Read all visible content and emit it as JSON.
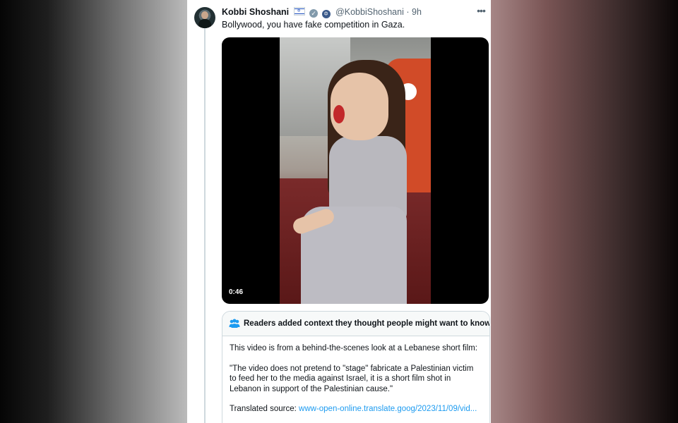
{
  "tweet": {
    "author_name": "Kobbi Shoshani",
    "author_handle": "@KobbiShoshani",
    "separator": "·",
    "time_ago": "9h",
    "text": "Bollywood, you have fake competition in Gaza.",
    "more_icon": "more-icon",
    "verified_icon": "verified-badge-icon",
    "flag_icon": "israel-flag-icon",
    "affiliation_icon": "affiliation-badge-icon"
  },
  "video": {
    "duration": "0:46"
  },
  "community_note": {
    "icon": "people-icon",
    "title": "Readers added context they thought people might want to know",
    "paragraph1": "This video is from a behind-the-scenes look at a Lebanese short film:",
    "paragraph2": "\"The video does not pretend to \"stage\" fabricate a Palestinian victim to feed her to the media against Israel, it is a short film shot in Lebanon in support of the Palestinian cause.\"",
    "source_label": "Translated source: ",
    "source_link": "www-open-online.translate.goog/2023/11/09/vid..."
  },
  "colors": {
    "link": "#1d9bf0",
    "text": "#0f1419",
    "muted": "#536471",
    "border": "#cfd9de"
  }
}
